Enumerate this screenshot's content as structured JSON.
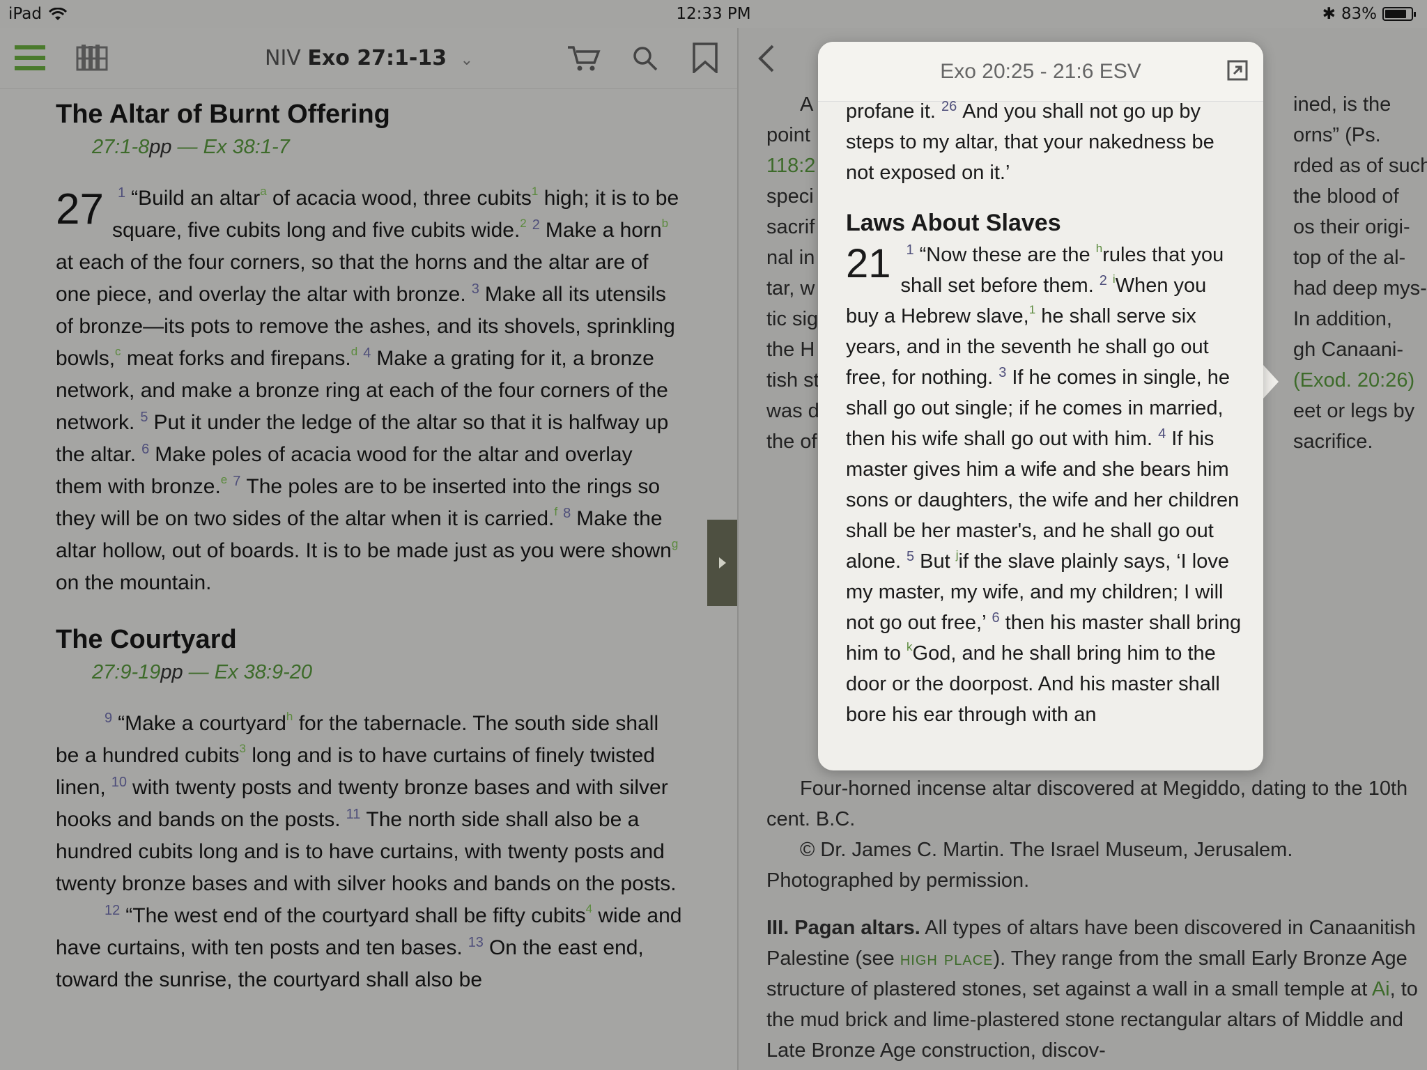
{
  "status": {
    "device": "iPad",
    "time": "12:33 PM",
    "battery": "83%"
  },
  "toolbar": {
    "version": "NIV",
    "reference": "Exo 27:1-13"
  },
  "left": {
    "heading1": "The Altar of Burnt Offering",
    "xref1_a": "27:1-8",
    "xref1_b": "pp",
    "xref1_c": " — Ex 38:1-7",
    "chapter": "27",
    "heading2": "The Courtyard",
    "xref2_a": "27:9-19",
    "xref2_b": "pp",
    "xref2_c": " — Ex 38:9-20",
    "p1": [
      {
        "v": "1",
        "t": "“Build an altar"
      },
      {
        "f": "a"
      },
      {
        "t": " of acacia wood, three cubits"
      },
      {
        "f": "1"
      },
      {
        "t": " high; it is to be square, five cubits long and five cubits wide."
      },
      {
        "f": "2"
      },
      {
        "v": "2",
        "t": "Make a horn"
      },
      {
        "f": "b"
      },
      {
        "t": " at each of the four corners, so that the horns and the altar are of one piece, and overlay the altar with bronze."
      },
      {
        "v": "3",
        "t": "Make all its utensils of bronze—its pots to remove the ashes, and its shovels, sprinkling bowls,"
      },
      {
        "f": "c"
      },
      {
        "t": " meat forks and firepans."
      },
      {
        "f": "d"
      },
      {
        "v": "4",
        "t": "Make a grating for it, a bronze network, and make a bronze ring at each of the four corners of the network."
      },
      {
        "v": "5",
        "t": "Put it under the ledge of the altar so that it is halfway up the altar."
      },
      {
        "v": "6",
        "t": "Make poles of acacia wood for the altar and overlay them with bronze."
      },
      {
        "f": "e"
      },
      {
        "v": "7",
        "t": "The poles are to be inserted into the rings so they will be on two sides of the altar when it is carried."
      },
      {
        "f": "f"
      },
      {
        "v": "8",
        "t": "Make the altar hollow, out of boards. It is to be made just as you were shown"
      },
      {
        "f": "g"
      },
      {
        "t": " on the mountain."
      }
    ],
    "p2": [
      {
        "v": "9",
        "t": "“Make a courtyard"
      },
      {
        "f": "h"
      },
      {
        "t": " for the tabernacle. The south side shall be a hundred cubits"
      },
      {
        "f": "3"
      },
      {
        "t": " long and is to have curtains of finely twisted linen,"
      },
      {
        "v": "10",
        "t": "with twenty posts and twenty bronze bases and with silver hooks and bands on the posts."
      },
      {
        "v": "11",
        "t": "The north side shall also be a hundred cubits long and is to have curtains, with twenty posts and twenty bronze bases and with silver hooks and bands on the posts."
      }
    ],
    "p3": [
      {
        "v": "12",
        "t": "“The west end of the courtyard shall be fifty cubits"
      },
      {
        "f": "4"
      },
      {
        "t": " wide and have curtains, with ten posts and ten bases."
      },
      {
        "v": "13",
        "t": "On the east end, toward the sunrise, the courtyard shall also be"
      }
    ]
  },
  "right": {
    "lines_top": [
      {
        "l": "A",
        "r": "ined, is the"
      },
      {
        "l": "point",
        "r": "orns” (Ps."
      },
      {
        "l": "118:2",
        "r": "rded as of such"
      },
      {
        "l": "speci",
        "r": "the blood of"
      },
      {
        "l": "sacrif",
        "r": "os their origi-"
      },
      {
        "l": "nal in",
        "r": "top of the al-"
      },
      {
        "l": "tar, w",
        "r": "had deep mys-"
      },
      {
        "l": "tic sig",
        "r": "In addition,"
      },
      {
        "l": "the H",
        "r": "gh Canaani-"
      },
      {
        "l": "tish st",
        "r": "(Exod. 20:26)"
      },
      {
        "l": "was d",
        "r": "eet or legs by"
      },
      {
        "l": "the of",
        "r": "sacrifice."
      }
    ],
    "caption1": "Four-horned incense altar discovered at Megiddo, dating to the 10th cent. B.C.",
    "caption2": "© Dr. James C. Martin. The Israel Museum, Jerusalem. Photographed by permission.",
    "section_bold": "III. Pagan altars.",
    "section_text1": " All types of altars have been discovered in Canaanitish Palestine (see ",
    "section_link1": "high place",
    "section_text2": "). They range from the small Early Bronze Age structure of plastered stones, set against a wall in a small temple at ",
    "section_link2": "Ai",
    "section_text3": ", to the mud brick and lime-plastered stone rectangular altars of Middle and Late Bronze Age construction, discov-"
  },
  "popup": {
    "title": "Exo 20:25 - 21:6 ESV",
    "intro": "profane it.",
    "v26": "26",
    "v26_text": "And you shall not go up by steps to my altar, that your nakedness be not exposed on it.’",
    "heading": "Laws About Slaves",
    "chapter": "21",
    "verses": [
      {
        "v": "1",
        "t": "“Now these are the "
      },
      {
        "f": "h"
      },
      {
        "t": "rules that you shall set before them."
      },
      {
        "v": "2",
        "t": ""
      },
      {
        "f": "i"
      },
      {
        "t": "When you buy a Hebrew slave,"
      },
      {
        "f": "1"
      },
      {
        "t": " he shall serve six years, and in the seventh he shall go out free, for nothing."
      },
      {
        "v": "3",
        "t": "If he comes in single, he shall go out single; if he comes in married, then his wife shall go out with him."
      },
      {
        "v": "4",
        "t": "If his master gives him a wife and she bears him sons or daughters, the wife and her children shall be her master's, and he shall go out alone."
      },
      {
        "v": "5",
        "t": "But "
      },
      {
        "f": "j"
      },
      {
        "t": "if the slave plainly says, ‘I love my master, my wife, and my children; I will not go out free,’"
      },
      {
        "v": "6",
        "t": "then his master shall bring him to "
      },
      {
        "f": "k"
      },
      {
        "t": "God, and he shall bring him to the door or the doorpost. And his master shall bore his ear through with an"
      }
    ]
  }
}
